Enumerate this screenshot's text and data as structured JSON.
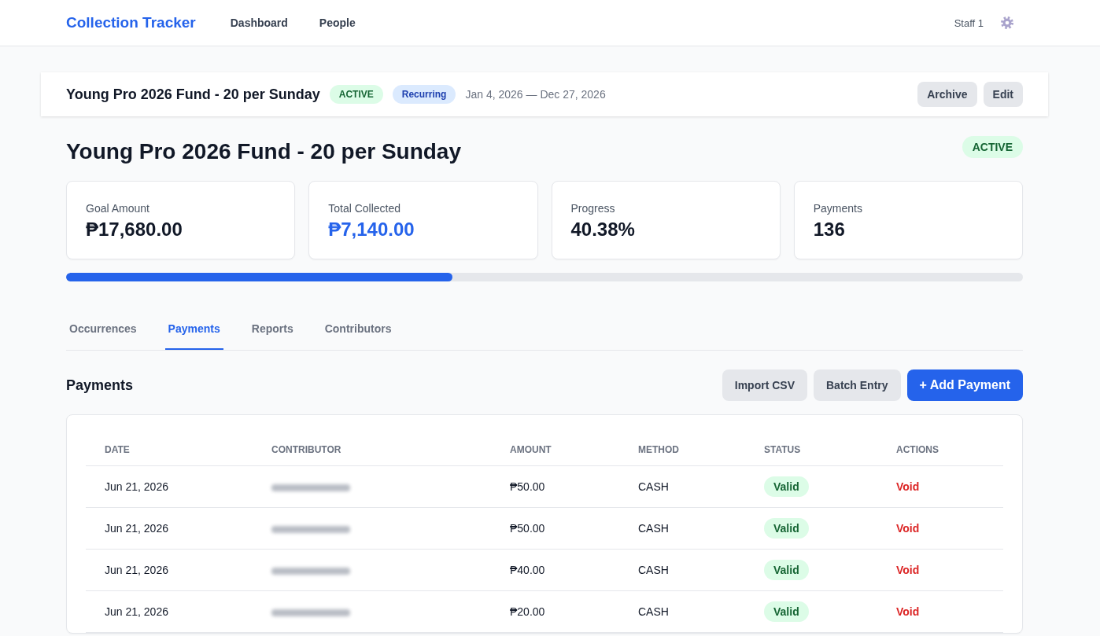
{
  "nav": {
    "brand": "Collection Tracker",
    "links": [
      {
        "label": "Dashboard"
      },
      {
        "label": "People"
      }
    ],
    "user": "Staff 1"
  },
  "header_bar": {
    "title": "Young Pro 2026 Fund - 20 per Sunday",
    "badges": [
      {
        "label": "ACTIVE",
        "kind": "status"
      },
      {
        "label": "Recurring",
        "kind": "type"
      }
    ],
    "date_range": "Jan 4, 2026 — Dec 27, 2026",
    "buttons": [
      "Archive",
      "Edit"
    ]
  },
  "fund": {
    "title": "Young Pro 2026 Fund - 20 per Sunday",
    "badge": {
      "label": "ACTIVE",
      "kind": "status"
    }
  },
  "stats": [
    {
      "label": "Goal Amount",
      "value": "₱17,680.00",
      "kind": "plain"
    },
    {
      "label": "Total Collected",
      "value": "₱7,140.00",
      "kind": "accent"
    },
    {
      "label": "Progress",
      "value": "40.38%",
      "kind": "plain"
    },
    {
      "label": "Payments",
      "value": "136",
      "kind": "plain"
    }
  ],
  "progress": {
    "level": 0.4038
  },
  "tabs": [
    {
      "label": "Occurrences",
      "selected": false
    },
    {
      "label": "Payments",
      "selected": true
    },
    {
      "label": "Reports",
      "selected": false
    },
    {
      "label": "Contributors",
      "selected": false
    }
  ],
  "payments": {
    "title": "Payments",
    "buttons": [
      {
        "label": "Import CSV",
        "kind": "secondary"
      },
      {
        "label": "Batch Entry",
        "kind": "secondary"
      },
      {
        "label": "+ Add Payment",
        "kind": "primary"
      }
    ],
    "table": {
      "columns": [
        "DATE",
        "CONTRIBUTOR",
        "AMOUNT",
        "METHOD",
        "STATUS",
        "ACTIONS"
      ],
      "rows": [
        {
          "date": "Jun 21, 2026",
          "contributor_blurred": true,
          "amount": "₱50.00",
          "method": "CASH",
          "status": "Valid",
          "action": "Void"
        },
        {
          "date": "Jun 21, 2026",
          "contributor_blurred": true,
          "amount": "₱50.00",
          "method": "CASH",
          "status": "Valid",
          "action": "Void"
        },
        {
          "date": "Jun 21, 2026",
          "contributor_blurred": true,
          "amount": "₱40.00",
          "method": "CASH",
          "status": "Valid",
          "action": "Void"
        },
        {
          "date": "Jun 21, 2026",
          "contributor_blurred": true,
          "amount": "₱20.00",
          "method": "CASH",
          "status": "Valid",
          "action": "Void"
        }
      ]
    }
  }
}
